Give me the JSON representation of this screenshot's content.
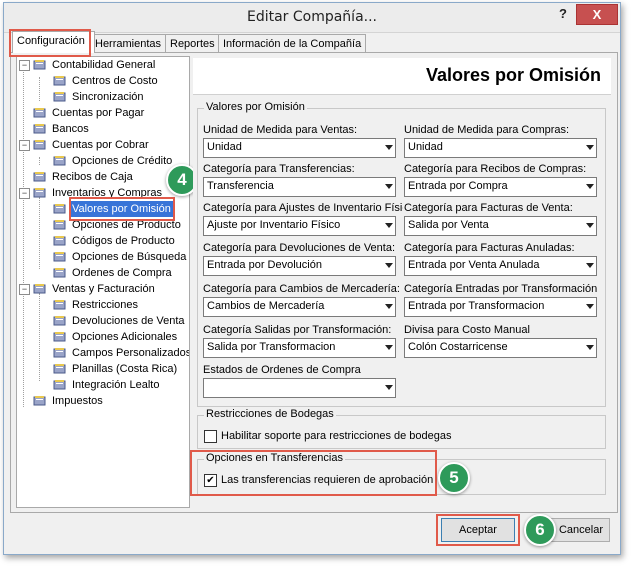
{
  "window": {
    "title": "Editar Compañía...",
    "help_icon": "?",
    "close_icon": "X"
  },
  "tabs": [
    {
      "label": "Configuración",
      "active": true
    },
    {
      "label": "Herramientas"
    },
    {
      "label": "Reportes"
    },
    {
      "label": "Información de la Compañía"
    }
  ],
  "tree": {
    "items": [
      {
        "label": "Contabilidad General",
        "expander": "−"
      },
      {
        "label": "Centros de Costo"
      },
      {
        "label": "Sincronización"
      },
      {
        "label": "Cuentas por Pagar"
      },
      {
        "label": "Bancos"
      },
      {
        "label": "Cuentas por Cobrar",
        "expander": "−"
      },
      {
        "label": "Opciones de Crédito"
      },
      {
        "label": "Recibos de Caja"
      },
      {
        "label": "Inventarios y Compras",
        "expander": "−"
      },
      {
        "label": "Valores por Omisión",
        "selected": true
      },
      {
        "label": "Opciones de Producto"
      },
      {
        "label": "Códigos de Producto"
      },
      {
        "label": "Opciones de Búsqueda"
      },
      {
        "label": "Ordenes de Compra"
      },
      {
        "label": "Ventas y Facturación",
        "expander": "−"
      },
      {
        "label": "Restricciones"
      },
      {
        "label": "Devoluciones de Venta"
      },
      {
        "label": "Opciones Adicionales"
      },
      {
        "label": "Campos Personalizados"
      },
      {
        "label": "Planillas (Costa Rica)"
      },
      {
        "label": "Integración Lealto"
      },
      {
        "label": "Impuestos"
      }
    ]
  },
  "panel": {
    "header": "Valores por Omisión",
    "group_defaults": {
      "title": "Valores por Omisión",
      "fields": [
        {
          "label": "Unidad de Medida para Ventas:",
          "value": "Unidad"
        },
        {
          "label": "Unidad de Medida para Compras:",
          "value": "Unidad"
        },
        {
          "label": "Categoría para Transferencias:",
          "value": "Transferencia"
        },
        {
          "label": "Categoría para Recibos de Compras:",
          "value": "Entrada por Compra"
        },
        {
          "label": "Categoría para Ajustes de Inventario Físic",
          "value": "Ajuste por Inventario Físico"
        },
        {
          "label": "Categoría para Facturas de Venta:",
          "value": "Salida por Venta"
        },
        {
          "label": "Categoría para Devoluciones de Venta:",
          "value": "Entrada por Devolución"
        },
        {
          "label": "Categoría para Facturas Anuladas:",
          "value": "Entrada por Venta Anulada"
        },
        {
          "label": "Categoría para Cambios de Mercadería:",
          "value": "Cambios de Mercadería"
        },
        {
          "label": "Categoría Entradas por Transformación",
          "value": "Entrada por Transformacion"
        },
        {
          "label": "Categoría Salidas por Transformación:",
          "value": "Salida por Transformacion"
        },
        {
          "label": "Divisa para Costo Manual",
          "value": "Colón Costarricense"
        },
        {
          "label": "Estados de Ordenes de Compra",
          "value": ""
        }
      ]
    },
    "group_warehouse": {
      "title": "Restricciones de Bodegas",
      "checkbox_label": "Habilitar soporte para restricciones de bodegas",
      "checked": false
    },
    "group_transfers": {
      "title": "Opciones en Transferencias",
      "checkbox_label": "Las transferencias requieren de aprobación",
      "checked": true,
      "check_glyph": "✔"
    }
  },
  "buttons": {
    "accept": "Aceptar",
    "cancel": "Cancelar"
  },
  "callouts": [
    "4",
    "5",
    "6"
  ],
  "colors": {
    "highlight": "#e05a4a",
    "badge": "#2e9a5a",
    "selection": "#3874d8"
  }
}
